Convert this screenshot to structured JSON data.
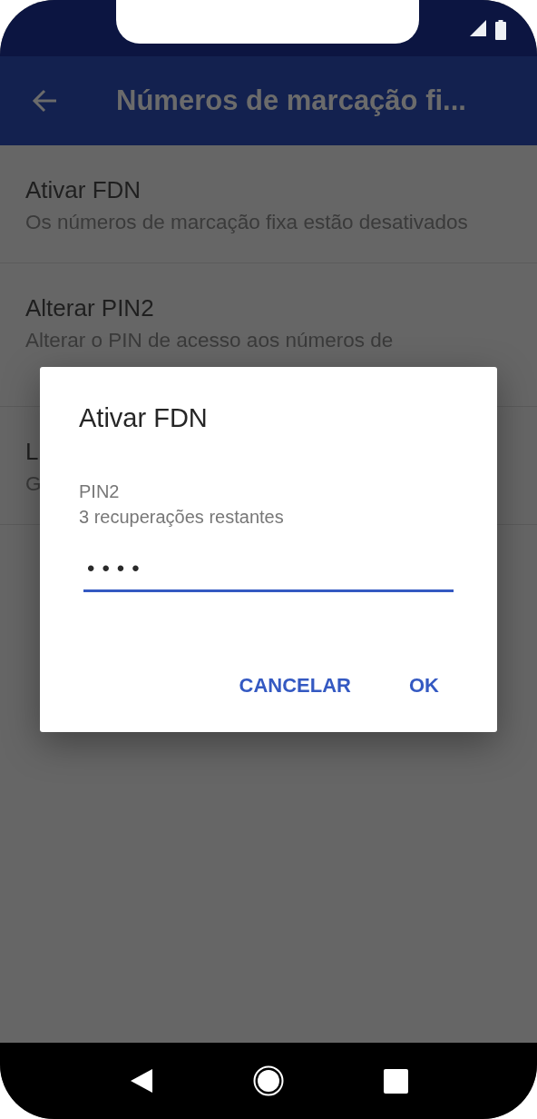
{
  "app_bar": {
    "title": "Números de marcação fi..."
  },
  "settings": [
    {
      "title": "Ativar FDN",
      "summary": "Os números de marcação fixa estão desativados"
    },
    {
      "title": "Alterar PIN2",
      "summary": "Alterar o PIN de acesso aos números de"
    },
    {
      "title": "L",
      "summary": "G"
    }
  ],
  "dialog": {
    "title": "Ativar FDN",
    "label": "PIN2",
    "hint": "3 recuperações restantes",
    "value": "••••",
    "focused": true,
    "buttons": [
      {
        "label": "CANCELAR"
      },
      {
        "label": "OK"
      }
    ]
  }
}
